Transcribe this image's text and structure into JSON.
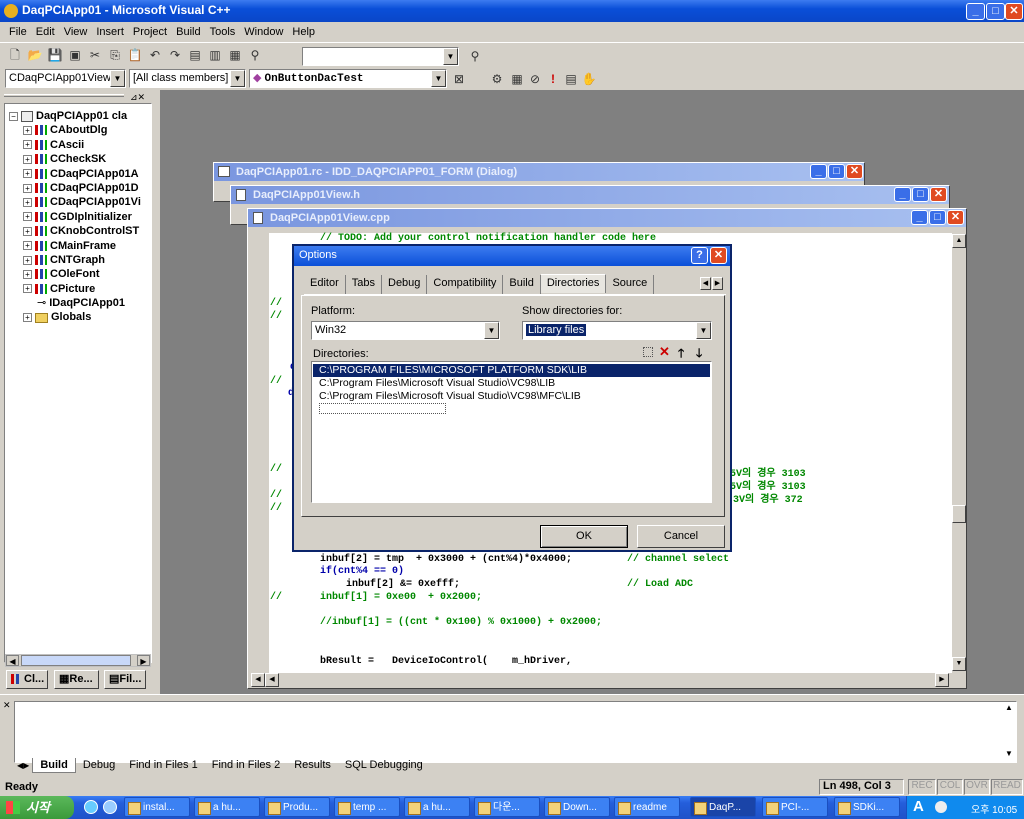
{
  "app": {
    "title": "DaqPCIApp01 - Microsoft Visual C++"
  },
  "menu": [
    "File",
    "Edit",
    "View",
    "Insert",
    "Project",
    "Build",
    "Tools",
    "Window",
    "Help"
  ],
  "wizard": {
    "class_combo": "CDaqPCIApp01View",
    "filter_combo": "[All class members]",
    "member_combo": "OnButtonDacTest"
  },
  "workspace": {
    "root": "DaqPCIApp01 cla",
    "items": [
      "CAboutDlg",
      "CAscii",
      "CCheckSK",
      "CDaqPCIApp01A",
      "CDaqPCIApp01D",
      "CDaqPCIApp01Vi",
      "CGDIplnitializer",
      "CKnobControlST",
      "CMainFrame",
      "CNTGraph",
      "COleFont",
      "CPicture",
      "IDaqPCIApp01",
      "Globals"
    ],
    "tabs": [
      "Cl...",
      "Re...",
      "Fil..."
    ]
  },
  "windows": {
    "rc": "DaqPCIApp01.rc - IDD_DAQPCIAPP01_FORM (Dialog)",
    "h": "DaqPCIApp01View.h",
    "cpp": "DaqPCIApp01View.cpp"
  },
  "code": {
    "todo": "// TODO: Add your control notification handler code here",
    "c1": "//",
    "c2": "//",
    "c3": "//",
    "c4": "//",
    "c5": "//",
    "c6": "//",
    "c7": "//",
    "d1": "d",
    "d2": "d",
    "r1": "2.5V의 경우 3103",
    "r2": "2.5V의 경우 3103",
    "r3": "3V의 경우 372",
    "l1": "inbuf[2] = tmp  + 0x3000 + (cnt%4)*0x4000;",
    "l1c": "// channel select",
    "l2": "if(cnt%4 == 0)",
    "l3": "inbuf[2] &= 0xefff;",
    "l3c": "// Load ADC",
    "l4a": "//",
    "l4": "inbuf[1] = 0xe00  + 0x2000;",
    "l5": "//inbuf[1] = ((cnt * 0x100) % 0x1000) + 0x2000;",
    "l6": "bResult =   DeviceIoControl(    m_hDriver,"
  },
  "dialog": {
    "title": "Options",
    "tabs": [
      "Editor",
      "Tabs",
      "Debug",
      "Compatibility",
      "Build",
      "Directories",
      "Source"
    ],
    "platform_label": "Platform:",
    "platform_value": "Win32",
    "show_label": "Show directories for:",
    "show_value": "Library files",
    "dirs_label": "Directories:",
    "dirs": [
      "C:\\PROGRAM FILES\\MICROSOFT PLATFORM SDK\\LIB",
      "C:\\Program Files\\Microsoft Visual Studio\\VC98\\LIB",
      "C:\\Program Files\\Microsoft Visual Studio\\VC98\\MFC\\LIB"
    ],
    "ok": "OK",
    "cancel": "Cancel"
  },
  "output": {
    "tabs": [
      "Build",
      "Debug",
      "Find in Files 1",
      "Find in Files 2",
      "Results",
      "SQL Debugging"
    ]
  },
  "status": {
    "text": "Ready",
    "pos": "Ln 498, Col 3",
    "ind": [
      "REC",
      "COL",
      "OVR",
      "READ"
    ]
  },
  "taskbar": {
    "start": "시작",
    "items": [
      "instal...",
      "a hu...",
      "Produ...",
      "temp ...",
      "a hu...",
      "다운...",
      "Down...",
      "readme",
      "DaqP...",
      "PCI-...",
      "SDKi..."
    ],
    "clock": "오후 10:05",
    "ime": "A"
  },
  "colors": {
    "titlebar": "#0a246a",
    "selection": "#0a246a",
    "taskbar": "#245edb",
    "comment": "#008000",
    "keyword": "#0000a0"
  }
}
